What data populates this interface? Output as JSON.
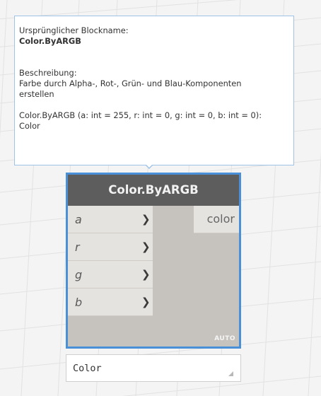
{
  "tooltip": {
    "original_name_label": "Ursprünglicher Blockname:",
    "original_name_value": "Color.ByARGB",
    "description_label": "Beschreibung:",
    "description_line1": "Farbe durch Alpha-, Rot-, Grün- und Blau-Komponenten",
    "description_line2": "erstellen",
    "signature_line1": "Color.ByARGB (a: int = 255, r: int = 0, g: int = 0, b: int = 0):",
    "signature_line2": "Color"
  },
  "node": {
    "title": "Color.ByARGB",
    "inputs": [
      {
        "name": "a",
        "chevron": "❯"
      },
      {
        "name": "r",
        "chevron": "❯"
      },
      {
        "name": "g",
        "chevron": "❯"
      },
      {
        "name": "b",
        "chevron": "❯"
      }
    ],
    "output": "color",
    "lacing": "AUTO"
  },
  "preview": {
    "value": "Color"
  },
  "colors": {
    "selection_border": "#4a90d9",
    "header_bg": "#5d5d5d",
    "node_body": "#c6c3bf",
    "port_bg": "#e5e3df",
    "canvas_bg": "#f4f4f4"
  }
}
